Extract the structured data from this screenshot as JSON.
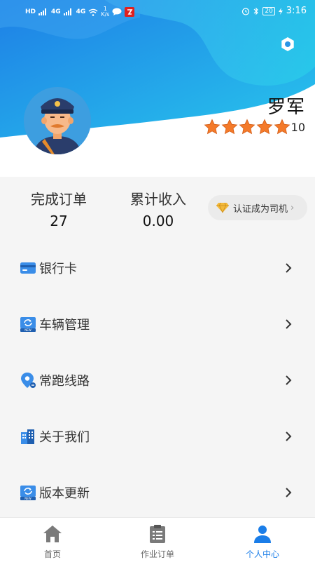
{
  "status_bar": {
    "network_label": "HD",
    "signal_1": "4G",
    "signal_2": "4G",
    "speed_value": "1",
    "speed_unit": "K/s",
    "battery": "20",
    "time": "3:16"
  },
  "profile": {
    "name": "罗军",
    "rating_stars": 5,
    "rating_value": "10"
  },
  "stats": {
    "orders_label": "完成订单",
    "orders_value": "27",
    "income_label": "累计收入",
    "income_value": "0.00"
  },
  "certify": {
    "label": "认证成为司机",
    "icon": "diamond-icon"
  },
  "menu": {
    "items": [
      {
        "label": "银行卡",
        "icon": "bank-card-icon"
      },
      {
        "label": "车辆管理",
        "icon": "vehicle-icon"
      },
      {
        "label": "常跑线路",
        "icon": "route-pin-icon"
      },
      {
        "label": "关于我们",
        "icon": "building-icon"
      },
      {
        "label": "版本更新",
        "icon": "update-icon"
      }
    ]
  },
  "nav": {
    "items": [
      {
        "label": "首页",
        "icon": "home-icon"
      },
      {
        "label": "作业订单",
        "icon": "clipboard-icon"
      },
      {
        "label": "个人中心",
        "icon": "person-icon"
      }
    ],
    "active_index": 2
  },
  "colors": {
    "accent": "#1a7de8",
    "header_gradient_start": "#2a8de8",
    "header_gradient_end": "#25c3e8",
    "star": "#f47a2a"
  }
}
